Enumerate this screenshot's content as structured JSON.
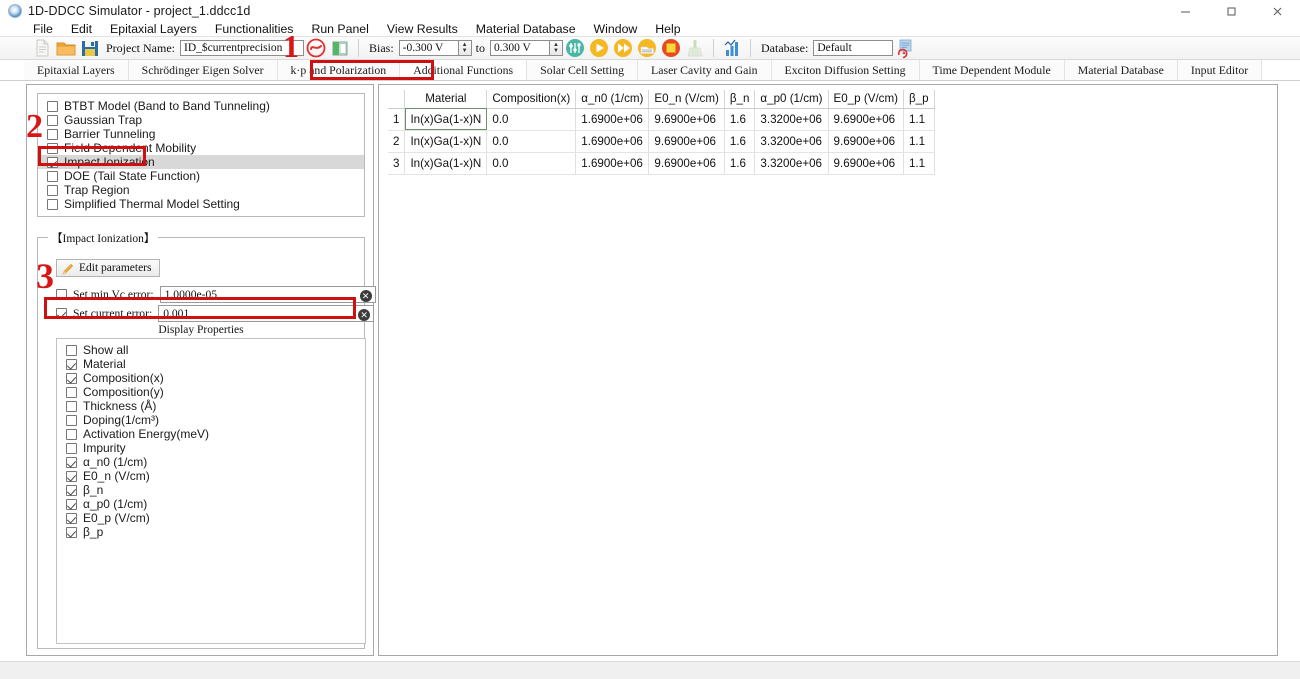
{
  "window": {
    "title": "1D-DDCC Simulator - project_1.ddcc1d",
    "minimize": "—",
    "maximize": "❐",
    "close": "✕"
  },
  "menubar": {
    "items": [
      {
        "label": "File"
      },
      {
        "label": "Edit"
      },
      {
        "label": "Epitaxial Layers"
      },
      {
        "label": "Functionalities"
      },
      {
        "label": "Run Panel"
      },
      {
        "label": "View Results"
      },
      {
        "label": "Material Database"
      },
      {
        "label": "Window"
      },
      {
        "label": "Help"
      }
    ]
  },
  "toolbar": {
    "new_icon": "new-document-icon",
    "open_icon": "open-folder-icon",
    "save_icon": "save-disk-icon",
    "project_name_label": "Project Name:",
    "project_name_value": "ID_$currentprecision",
    "refresh_icon": "refresh-icon",
    "structure_icon": "structure-icon",
    "bias_label": "Bias:",
    "bias_from_value": "-0.300 V",
    "bias_to_label": "to",
    "bias_to_value": "0.300 V",
    "settings_icon": "sliders-icon",
    "run_icon": "run-play-icon",
    "run_all_icon": "run-fast-forward-icon",
    "export_icon": "export-folder-icon",
    "stop_icon": "stop-icon",
    "clean_icon": "broom-icon",
    "plot_icon": "bar-chart-icon",
    "database_label": "Database:",
    "database_value": "Default",
    "database_refresh_icon": "database-refresh-icon"
  },
  "tabs": {
    "items": [
      {
        "label": "Epitaxial Layers",
        "active": false
      },
      {
        "label": "Schrödinger Eigen Solver",
        "active": false
      },
      {
        "label": "k·p and Polarization",
        "active": false
      },
      {
        "label": "Additional Functions",
        "active": true
      },
      {
        "label": "Solar Cell Setting",
        "active": false
      },
      {
        "label": "Laser Cavity and Gain",
        "active": false
      },
      {
        "label": "Exciton Diffusion Setting",
        "active": false
      },
      {
        "label": "Time Dependent Module",
        "active": false
      },
      {
        "label": "Material Database",
        "active": false
      },
      {
        "label": "Input Editor",
        "active": false
      }
    ]
  },
  "functions_list": {
    "items": [
      {
        "label": "BTBT Model (Band to Band Tunneling)",
        "checked": false,
        "highlight": false
      },
      {
        "label": "Gaussian Trap",
        "checked": false,
        "highlight": false
      },
      {
        "label": "Barrier Tunneling",
        "checked": false,
        "highlight": false
      },
      {
        "label": "Field Dependent Mobility",
        "checked": false,
        "highlight": false
      },
      {
        "label": "Impact Ionization",
        "checked": true,
        "highlight": true
      },
      {
        "label": "DOE (Tail State Function)",
        "checked": false,
        "highlight": false
      },
      {
        "label": "Trap Region",
        "checked": false,
        "highlight": false
      },
      {
        "label": "Simplified Thermal Model Setting",
        "checked": false,
        "highlight": false
      }
    ]
  },
  "impact_ionization": {
    "group_title": "【Impact Ionization】",
    "edit_button": "Edit parameters",
    "pencil_icon": "pencil-icon",
    "min_vc": {
      "label": "Set min Vc error:",
      "checked": false,
      "value": "1.0000e-05",
      "clear_icon": "clear-x-icon"
    },
    "current_error": {
      "label": "Set current error:",
      "checked": true,
      "value": "0.001",
      "clear_icon": "clear-x-icon"
    },
    "display_properties_title": "Display Properties",
    "display_properties": [
      {
        "label": "Show all",
        "checked": false
      },
      {
        "label": "Material",
        "checked": true
      },
      {
        "label": "Composition(x)",
        "checked": true
      },
      {
        "label": "Composition(y)",
        "checked": false
      },
      {
        "label": "Thickness (Å)",
        "checked": false
      },
      {
        "label": "Doping(1/cm³)",
        "checked": false
      },
      {
        "label": "Activation Energy(meV)",
        "checked": false
      },
      {
        "label": "Impurity",
        "checked": false
      },
      {
        "label": "α_n0 (1/cm)",
        "checked": true
      },
      {
        "label": "E0_n (V/cm)",
        "checked": true
      },
      {
        "label": "β_n",
        "checked": true
      },
      {
        "label": "α_p0 (1/cm)",
        "checked": true
      },
      {
        "label": "E0_p (V/cm)",
        "checked": true
      },
      {
        "label": "β_p",
        "checked": true
      }
    ]
  },
  "table": {
    "columns": [
      "Material",
      "Composition(x)",
      "α_n0 (1/cm)",
      "E0_n (V/cm)",
      "β_n",
      "α_p0 (1/cm)",
      "E0_p (V/cm)",
      "β_p"
    ],
    "rows": [
      {
        "index": "1",
        "cells": [
          "In(x)Ga(1-x)N",
          "0.0",
          "1.6900e+06",
          "9.6900e+06",
          "1.6",
          "3.3200e+06",
          "9.6900e+06",
          "1.1"
        ]
      },
      {
        "index": "2",
        "cells": [
          "In(x)Ga(1-x)N",
          "0.0",
          "1.6900e+06",
          "9.6900e+06",
          "1.6",
          "3.3200e+06",
          "9.6900e+06",
          "1.1"
        ]
      },
      {
        "index": "3",
        "cells": [
          "In(x)Ga(1-x)N",
          "0.0",
          "1.6900e+06",
          "9.6900e+06",
          "1.6",
          "3.3200e+06",
          "9.6900e+06",
          "1.1"
        ]
      }
    ]
  },
  "annotations": {
    "marker_1": "1",
    "marker_2": "2",
    "marker_3": "3",
    "color": "#d81616"
  }
}
